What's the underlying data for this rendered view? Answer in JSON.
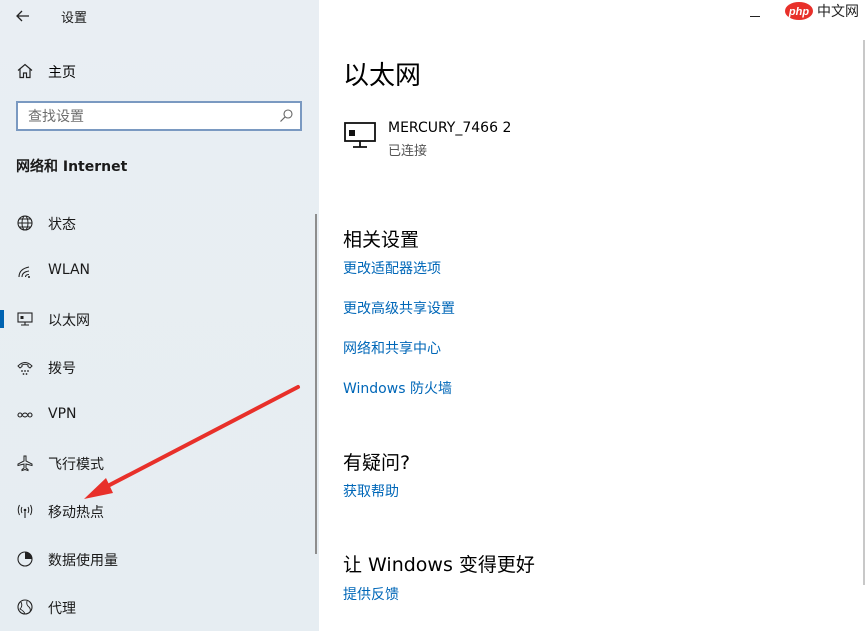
{
  "window": {
    "title": "设置"
  },
  "sidebar": {
    "home_label": "主页",
    "search_placeholder": "查找设置",
    "section_title": "网络和 Internet",
    "items": [
      {
        "label": "状态",
        "icon": "status-globe-icon",
        "selected": false
      },
      {
        "label": "WLAN",
        "icon": "wifi-icon",
        "selected": false
      },
      {
        "label": "以太网",
        "icon": "ethernet-icon",
        "selected": true
      },
      {
        "label": "拨号",
        "icon": "dialup-icon",
        "selected": false
      },
      {
        "label": "VPN",
        "icon": "vpn-icon",
        "selected": false
      },
      {
        "label": "飞行模式",
        "icon": "airplane-icon",
        "selected": false
      },
      {
        "label": "移动热点",
        "icon": "hotspot-icon",
        "selected": false
      },
      {
        "label": "数据使用量",
        "icon": "data-usage-icon",
        "selected": false
      },
      {
        "label": "代理",
        "icon": "proxy-globe-icon",
        "selected": false
      }
    ]
  },
  "main": {
    "title": "以太网",
    "network": {
      "name": "MERCURY_7466 2",
      "status": "已连接"
    },
    "related_settings": {
      "heading": "相关设置",
      "links": [
        "更改适配器选项",
        "更改高级共享设置",
        "网络和共享中心",
        "Windows 防火墙"
      ]
    },
    "help": {
      "heading": "有疑问?",
      "link": "获取帮助"
    },
    "feedback": {
      "heading": "让 Windows 变得更好",
      "link": "提供反馈"
    }
  },
  "watermark": {
    "brand": "php",
    "text": "中文网"
  },
  "colors": {
    "accent": "#0063b1",
    "link": "#0067b8",
    "annotation_arrow": "#e8302a",
    "sidebar_bg": "#e8eef3"
  }
}
